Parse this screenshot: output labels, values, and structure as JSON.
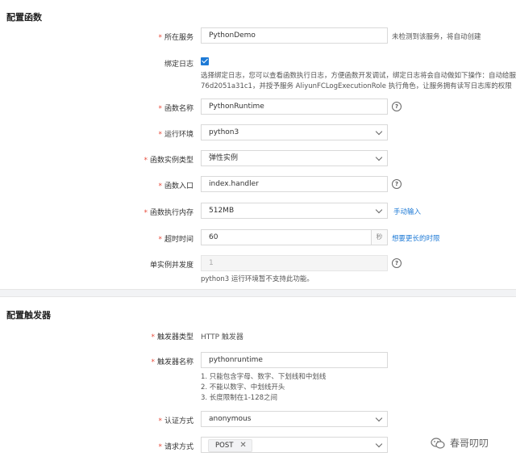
{
  "section1": {
    "title": "配置函数"
  },
  "service": {
    "label": "所在服务",
    "value": "PythonDemo",
    "hint": "未检测到该服务，将自动创建"
  },
  "log": {
    "label": "绑定日志",
    "checked": true,
    "desc_line1": "选择绑定日志，您可以查看函数执行日志，方便函数开发调试，绑定日志将会自动做如下操作：自动给服务创",
    "desc_line2": "76d2051a31c1，并授予服务 AliyunFCLogExecutionRole 执行角色，让服务拥有读写日志库的权限（日志库"
  },
  "func_name": {
    "label": "函数名称",
    "value": "PythonRuntime"
  },
  "runtime": {
    "label": "运行环境",
    "value": "python3"
  },
  "instance_type": {
    "label": "函数实例类型",
    "value": "弹性实例"
  },
  "entry": {
    "label": "函数入口",
    "value": "index.handler"
  },
  "memory": {
    "label": "函数执行内存",
    "value": "512MB",
    "link": "手动输入"
  },
  "timeout": {
    "label": "超时时间",
    "value": "60",
    "suffix": "秒",
    "link": "想要更长的时限"
  },
  "concurrency": {
    "label": "单实例并发度",
    "value": "1",
    "note": "python3 运行环境暂不支持此功能。"
  },
  "section2": {
    "title": "配置触发器"
  },
  "trigger_type": {
    "label": "触发器类型",
    "value": "HTTP 触发器"
  },
  "trigger_name": {
    "label": "触发器名称",
    "value": "pythonruntime",
    "rules": [
      "1. 只能包含字母、数字、下划线和中划线",
      "2. 不能以数字、中划线开头",
      "3. 长度限制在1-128之间"
    ]
  },
  "auth": {
    "label": "认证方式",
    "value": "anonymous"
  },
  "method": {
    "label": "请求方式",
    "tag": "POST",
    "tag_close": "✕"
  },
  "watermark": {
    "text": "春哥叨叨"
  },
  "help_glyph": "?"
}
